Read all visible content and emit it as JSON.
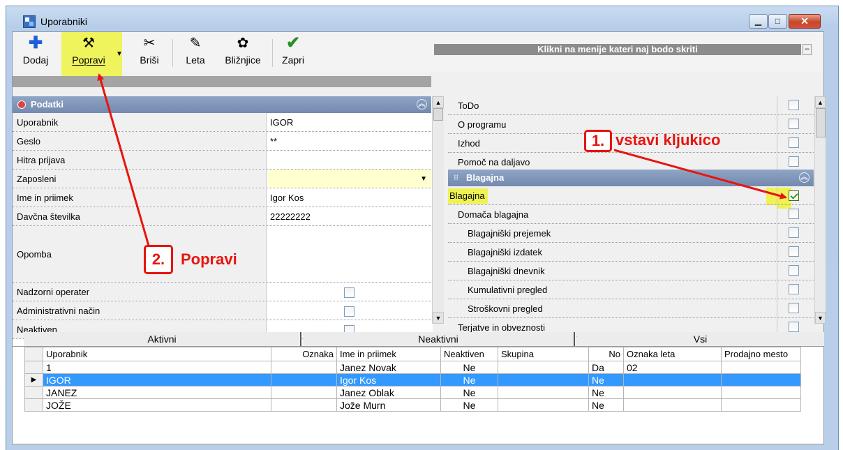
{
  "window": {
    "title": "Uporabniki",
    "min": "▁",
    "max": "□",
    "close": "✕"
  },
  "toolbar": {
    "add": "Dodaj",
    "edit": "Popravi",
    "delete": "Briši",
    "years": "Leta",
    "shortcuts": "Bližnjice",
    "close": "Zapri"
  },
  "left": {
    "category": "Podatki",
    "rows": [
      {
        "label": "Uporabnik",
        "value": "IGOR"
      },
      {
        "label": "Geslo",
        "value": "**"
      },
      {
        "label": "Hitra prijava",
        "value": ""
      },
      {
        "label": "Zaposleni",
        "value": ""
      },
      {
        "label": "Ime in priimek",
        "value": "Igor Kos"
      },
      {
        "label": "Davčna številka",
        "value": "22222222"
      },
      {
        "label": "Opomba",
        "value": ""
      },
      {
        "label": "Nadzorni operater",
        "value": ""
      },
      {
        "label": "Administrativni način",
        "value": ""
      },
      {
        "label": "Neaktiven",
        "value": ""
      }
    ]
  },
  "right": {
    "title": "Klikni na menije kateri naj bodo skriti",
    "min_label": "–",
    "items_top": [
      "ToDo",
      "O programu",
      "Izhod",
      "Pomoč na daljavo"
    ],
    "category": "Blagajna",
    "items_cat": [
      {
        "label": "Blagajna",
        "checked": true
      },
      {
        "label": "Domača blagajna",
        "checked": false
      },
      {
        "label": "Blagajniški prejemek",
        "checked": false
      },
      {
        "label": "Blagajniški izdatek",
        "checked": false
      },
      {
        "label": "Blagajniški dnevnik",
        "checked": false
      },
      {
        "label": "Kumulativni pregled",
        "checked": false
      },
      {
        "label": "Stroškovni pregled",
        "checked": false
      },
      {
        "label": "Terjatve in obveznosti",
        "checked": false
      }
    ]
  },
  "tabs": [
    "Aktivni",
    "Neaktivni",
    "Vsi"
  ],
  "table": {
    "headers": [
      "Uporabnik",
      "Oznaka",
      "Ime in priimek",
      "Neaktiven",
      "Skupina",
      "No",
      "Oznaka leta",
      "Prodajno mesto"
    ],
    "rows": [
      [
        "1",
        "",
        "Janez Novak",
        "Ne",
        "",
        "Da",
        "02",
        ""
      ],
      [
        "IGOR",
        "",
        "Igor Kos",
        "Ne",
        "",
        "Ne",
        "",
        ""
      ],
      [
        "JANEZ",
        "",
        "Janez Oblak",
        "Ne",
        "",
        "Ne",
        "",
        ""
      ],
      [
        "JOŽE",
        "",
        "Jože Murn",
        "Ne",
        "",
        "Ne",
        "",
        ""
      ]
    ],
    "selected_row": 1
  },
  "annotations": {
    "step1_num": "1.",
    "step1_text": "vstavi kljukico",
    "step2_num": "2.",
    "step2_text": "Popravi"
  },
  "colors": {
    "annotation": "#e8140e",
    "highlight": "#eef253",
    "selection": "#3399ff"
  }
}
